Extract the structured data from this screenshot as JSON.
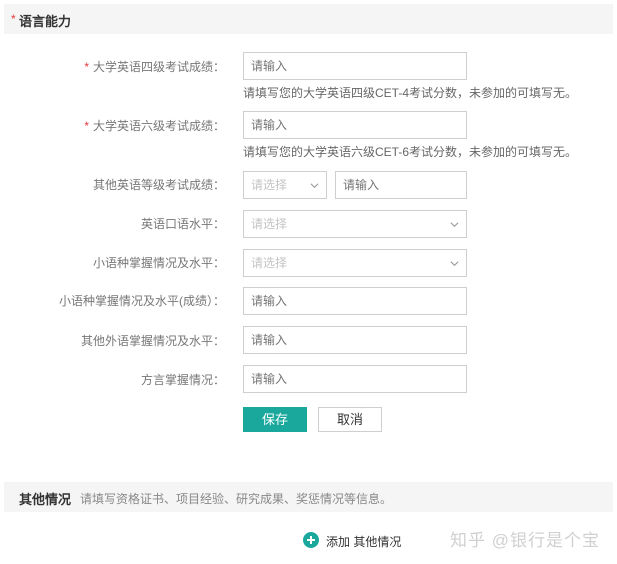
{
  "section": {
    "required_mark": "*",
    "title": "语言能力"
  },
  "fields": [
    {
      "label": "大学英语四级考试成绩：",
      "required": "*",
      "placeholder": "请输入",
      "hint": "请填写您的大学英语四级CET-4考试分数，未参加的可填写无。"
    },
    {
      "label": "大学英语六级考试成绩：",
      "required": "*",
      "placeholder": "请输入",
      "hint": "请填写您的大学英语六级CET-6考试分数，未参加的可填写无。"
    },
    {
      "label": "其他英语等级考试成绩：",
      "select_placeholder": "请选择",
      "placeholder": "请输入"
    },
    {
      "label": "英语口语水平：",
      "select_placeholder": "请选择"
    },
    {
      "label": "小语种掌握情况及水平：",
      "select_placeholder": "请选择"
    },
    {
      "label": "小语种掌握情况及水平(成绩）：",
      "placeholder": "请输入"
    },
    {
      "label": "其他外语掌握情况及水平：",
      "placeholder": "请输入"
    },
    {
      "label": "方言掌握情况：",
      "placeholder": "请输入"
    }
  ],
  "buttons": {
    "save": "保存",
    "cancel": "取消"
  },
  "other": {
    "title": "其他情况",
    "description": "请填写资格证书、项目经验、研究成果、奖惩情况等信息。",
    "add_label": "添加 其他情况"
  },
  "watermark": "知乎 @银行是个宝",
  "colors": {
    "accent": "#1aa89d",
    "required": "#e4393c",
    "section_bg": "#f5f5f5"
  }
}
